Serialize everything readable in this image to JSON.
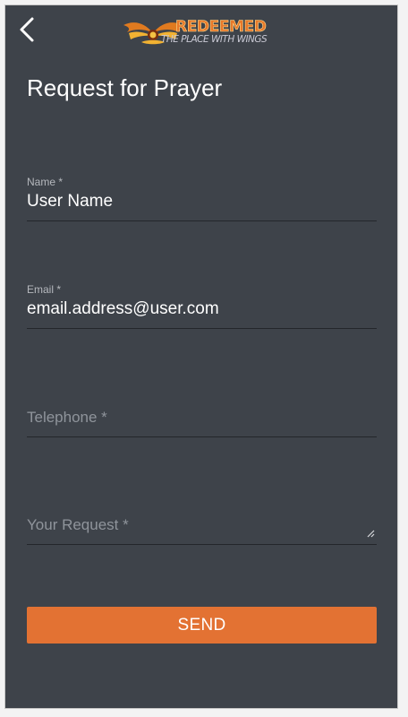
{
  "header": {
    "logo_name": "REDEEMED",
    "logo_tagline": "THE PLACE WITH WINGS",
    "back_icon": "chevron-left-icon"
  },
  "page": {
    "title": "Request for Prayer"
  },
  "form": {
    "name": {
      "label": "Name *",
      "value": "User Name"
    },
    "email": {
      "label": "Email *",
      "value": "email.address@user.com"
    },
    "telephone": {
      "placeholder": "Telephone *",
      "value": ""
    },
    "request": {
      "placeholder": "Your Request *",
      "value": ""
    },
    "send_label": "SEND"
  },
  "colors": {
    "background": "#3e434a",
    "accent": "#e37233",
    "text": "#ffffff",
    "muted": "#8f949b"
  }
}
